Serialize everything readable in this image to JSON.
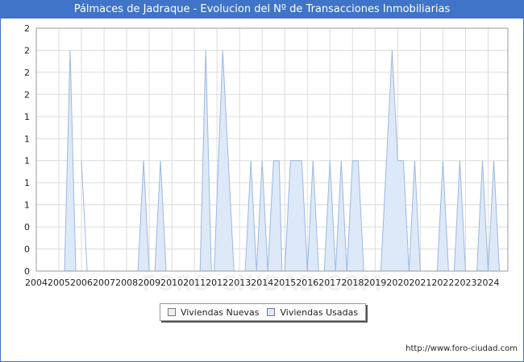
{
  "header": {
    "title": "Pálmaces de Jadraque - Evolucion del Nº de Transacciones Inmobiliarias"
  },
  "footer": {
    "url": "http://www.foro-ciudad.com",
    "watermark": "FORO-CIUDAD.COM"
  },
  "colors": {
    "title_bg": "#3f74c8",
    "nuevas": "#f0f0f0",
    "usadas": "#dde9f8",
    "usadas_stroke": "#9cb8e0",
    "grid": "#dcdcdc"
  },
  "chart_data": {
    "type": "area",
    "title": "Pálmaces de Jadraque - Evolucion del Nº de Transacciones Inmobiliarias",
    "xlabel": "",
    "ylabel": "",
    "xlim": [
      2004,
      2024.875
    ],
    "ylim": [
      0,
      2.2
    ],
    "x_ticks": [
      "2004",
      "2005",
      "2006",
      "2007",
      "2008",
      "2009",
      "2010",
      "2011",
      "2012",
      "2013",
      "2014",
      "2015",
      "2016",
      "2017",
      "2018",
      "2019",
      "2020",
      "2021",
      "2022",
      "2023",
      "2024"
    ],
    "y_tick_values": [
      0,
      0.2,
      0.4,
      0.6,
      0.8,
      1.0,
      1.2,
      1.4,
      1.6,
      1.8,
      2.0,
      2.2
    ],
    "y_tick_labels": [
      "0",
      "0",
      "0",
      "1",
      "1",
      "1",
      "1",
      "1",
      "2",
      "2",
      "2",
      "2"
    ],
    "grid": true,
    "legend_position": "bottom-center",
    "series": [
      {
        "name": "Viviendas Nuevas",
        "points": []
      },
      {
        "name": "Viviendas Usadas",
        "points": [
          [
            2005.25,
            0
          ],
          [
            2005.5,
            2
          ],
          [
            2005.75,
            0
          ],
          [
            2006.0,
            1
          ],
          [
            2006.25,
            0
          ],
          [
            2008.5,
            0
          ],
          [
            2008.75,
            1
          ],
          [
            2009.0,
            0
          ],
          [
            2009.25,
            0
          ],
          [
            2009.5,
            1
          ],
          [
            2009.75,
            0
          ],
          [
            2011.25,
            0
          ],
          [
            2011.5,
            2
          ],
          [
            2011.75,
            0
          ],
          [
            2011.875,
            0
          ],
          [
            2012.25,
            2
          ],
          [
            2012.75,
            0
          ],
          [
            2013.25,
            0
          ],
          [
            2013.5,
            1
          ],
          [
            2013.75,
            0
          ],
          [
            2013.75,
            0
          ],
          [
            2014.0,
            1
          ],
          [
            2014.25,
            0
          ],
          [
            2014.25,
            0
          ],
          [
            2014.5,
            1
          ],
          [
            2014.75,
            1
          ],
          [
            2014.875,
            0
          ],
          [
            2015.0,
            0
          ],
          [
            2015.25,
            1
          ],
          [
            2015.75,
            1
          ],
          [
            2016.0,
            0
          ],
          [
            2016.0,
            0
          ],
          [
            2016.25,
            1
          ],
          [
            2016.5,
            0
          ],
          [
            2016.75,
            0
          ],
          [
            2017.0,
            1
          ],
          [
            2017.25,
            0
          ],
          [
            2017.25,
            0
          ],
          [
            2017.5,
            1
          ],
          [
            2017.75,
            0
          ],
          [
            2017.75,
            0
          ],
          [
            2018.0,
            1
          ],
          [
            2018.25,
            1
          ],
          [
            2018.5,
            0
          ],
          [
            2019.25,
            0
          ],
          [
            2019.5,
            1
          ],
          [
            2019.75,
            2
          ],
          [
            2020.0,
            1
          ],
          [
            2020.25,
            1
          ],
          [
            2020.5,
            0
          ],
          [
            2020.5,
            0
          ],
          [
            2020.75,
            1
          ],
          [
            2021.0,
            0
          ],
          [
            2021.75,
            0
          ],
          [
            2022.0,
            1
          ],
          [
            2022.25,
            0
          ],
          [
            2022.5,
            0
          ],
          [
            2022.75,
            1
          ],
          [
            2023.0,
            0
          ],
          [
            2023.5,
            0
          ],
          [
            2023.75,
            1
          ],
          [
            2024.0,
            0
          ],
          [
            2024.0,
            0
          ],
          [
            2024.25,
            1
          ],
          [
            2024.5,
            0
          ]
        ]
      }
    ]
  }
}
